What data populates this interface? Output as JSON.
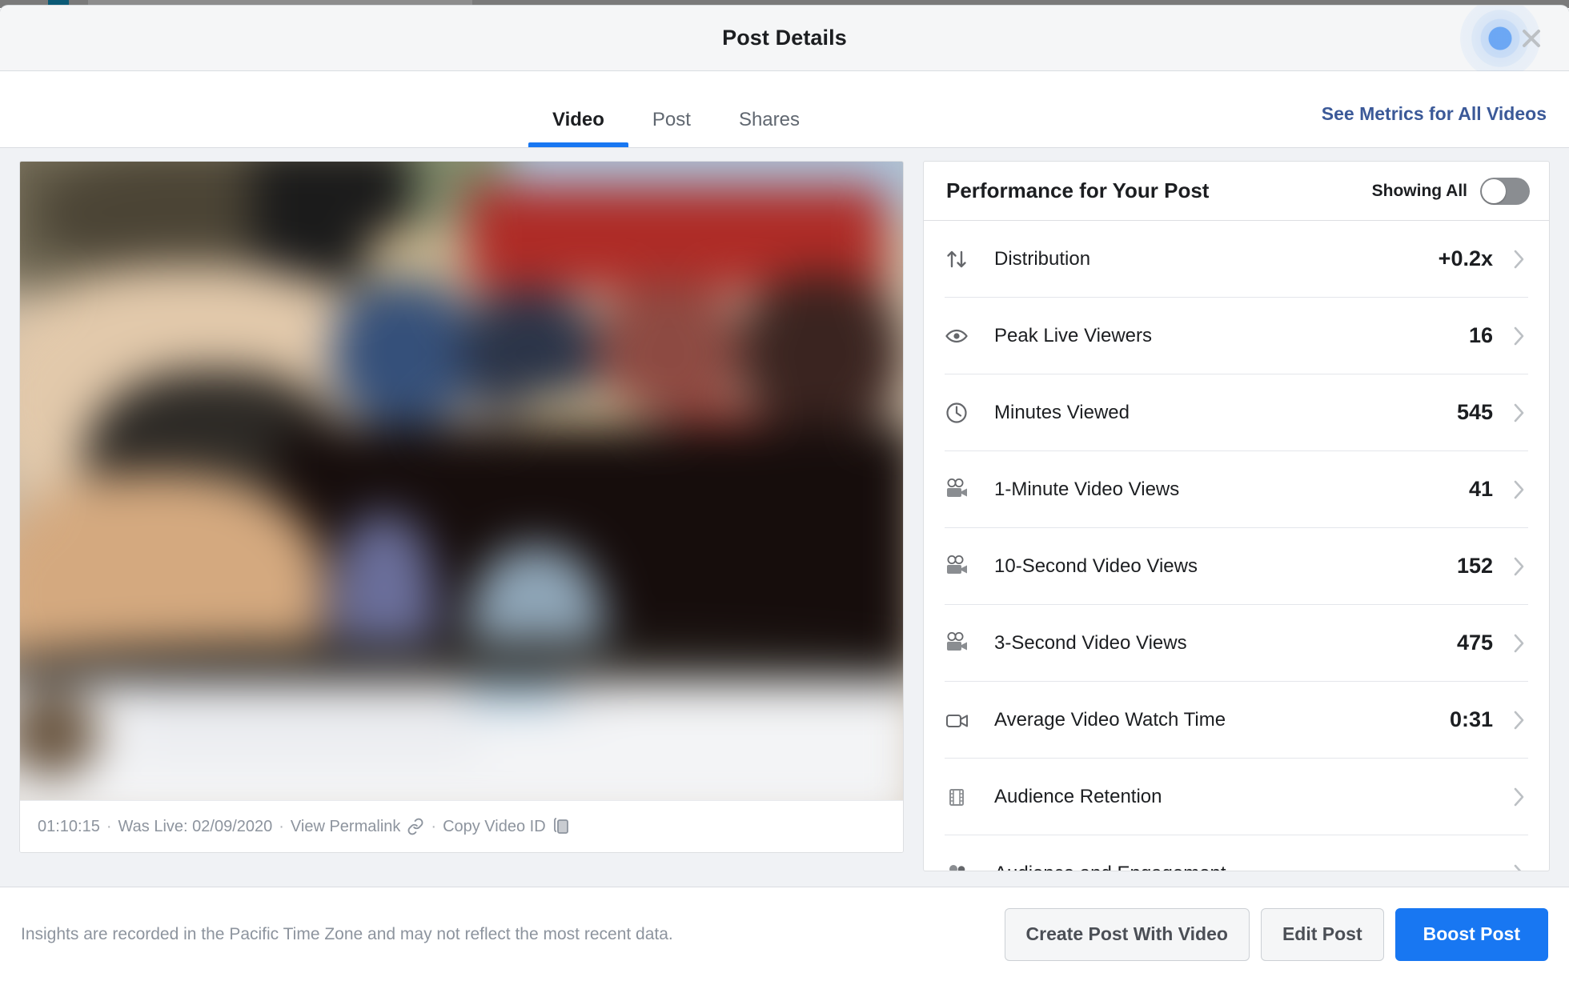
{
  "window": {
    "title": "Post Details",
    "close_icon": "close-icon",
    "cursor_indicator": "click-indicator",
    "accent_color": "#1877f2",
    "link_color": "#3b5998"
  },
  "tabs": {
    "items": [
      {
        "label": "Video",
        "active": true
      },
      {
        "label": "Post",
        "active": false
      },
      {
        "label": "Shares",
        "active": false
      }
    ],
    "see_metrics_link": "See Metrics for All Videos"
  },
  "video": {
    "duration": "01:10:15",
    "separator": "·",
    "was_live": "Was Live: 02/09/2020",
    "view_permalink": "View Permalink",
    "permalink_icon": "link-icon",
    "copy_video_id": "Copy Video ID",
    "copy_icon": "copy-icon"
  },
  "performance": {
    "title": "Performance for Your Post",
    "showing_all_label": "Showing All",
    "toggle_state": "off",
    "metrics": [
      {
        "icon": "sort-arrows-icon",
        "label": "Distribution",
        "value": "+0.2x"
      },
      {
        "icon": "eye-icon",
        "label": "Peak Live Viewers",
        "value": "16"
      },
      {
        "icon": "clock-icon",
        "label": "Minutes Viewed",
        "value": "545"
      },
      {
        "icon": "movie-camera-icon",
        "label": "1-Minute Video Views",
        "value": "41"
      },
      {
        "icon": "movie-camera-icon",
        "label": "10-Second Video Views",
        "value": "152"
      },
      {
        "icon": "movie-camera-icon",
        "label": "3-Second Video Views",
        "value": "475"
      },
      {
        "icon": "video-camera-icon",
        "label": "Average Video Watch Time",
        "value": "0:31"
      },
      {
        "icon": "film-strip-icon",
        "label": "Audience Retention",
        "value": ""
      },
      {
        "icon": "people-icon",
        "label": "Audience and Engagement",
        "value": ""
      }
    ]
  },
  "footer": {
    "note": "Insights are recorded in the Pacific Time Zone and may not reflect the most recent data.",
    "create_post_label": "Create Post With Video",
    "edit_post_label": "Edit Post",
    "boost_post_label": "Boost Post"
  }
}
